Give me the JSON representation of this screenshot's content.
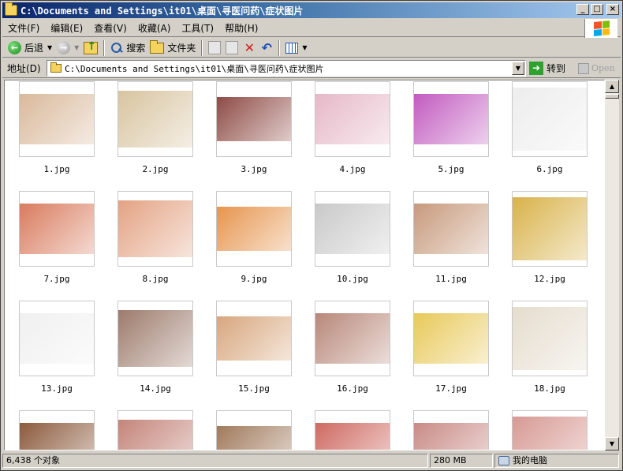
{
  "window": {
    "title": "C:\\Documents and Settings\\it01\\桌面\\寻医问药\\症状图片"
  },
  "menu": [
    "文件(F)",
    "编辑(E)",
    "查看(V)",
    "收藏(A)",
    "工具(T)",
    "帮助(H)"
  ],
  "toolbar": {
    "back_label": "后退",
    "search_label": "搜索",
    "folders_label": "文件夹"
  },
  "address": {
    "label": "地址(D)",
    "path": "C:\\Documents and Settings\\it01\\桌面\\寻医问药\\症状图片",
    "go_label": "转到",
    "open_label": "Open"
  },
  "files": [
    {
      "name": "1.jpg",
      "color": "#d9b99b"
    },
    {
      "name": "2.jpg",
      "color": "#d8c4a0"
    },
    {
      "name": "3.jpg",
      "color": "#8e4b45"
    },
    {
      "name": "4.jpg",
      "color": "#e6b8c8"
    },
    {
      "name": "5.jpg",
      "color": "#c25bc0"
    },
    {
      "name": "6.jpg",
      "color": "#ededed"
    },
    {
      "name": "7.jpg",
      "color": "#d97b5e"
    },
    {
      "name": "8.jpg",
      "color": "#e3a384"
    },
    {
      "name": "9.jpg",
      "color": "#e6954e"
    },
    {
      "name": "10.jpg",
      "color": "#c9c9c9"
    },
    {
      "name": "11.jpg",
      "color": "#c79a7c"
    },
    {
      "name": "12.jpg",
      "color": "#d8b24a"
    },
    {
      "name": "13.jpg",
      "color": "#f0f0f0"
    },
    {
      "name": "14.jpg",
      "color": "#9d7b6c"
    },
    {
      "name": "15.jpg",
      "color": "#d8a77e"
    },
    {
      "name": "16.jpg",
      "color": "#b8887a"
    },
    {
      "name": "17.jpg",
      "color": "#e8c95a"
    },
    {
      "name": "18.jpg",
      "color": "#e5dccd"
    },
    {
      "name": "",
      "color": "#8b5a3c"
    },
    {
      "name": "",
      "color": "#c4857a"
    },
    {
      "name": "",
      "color": "#a07a5c"
    },
    {
      "name": "",
      "color": "#cf6a62"
    },
    {
      "name": "",
      "color": "#c98b86"
    },
    {
      "name": "",
      "color": "#d79a94"
    }
  ],
  "status": {
    "objects": "6,438 个对象",
    "size": "280 MB",
    "location": "我的电脑"
  }
}
